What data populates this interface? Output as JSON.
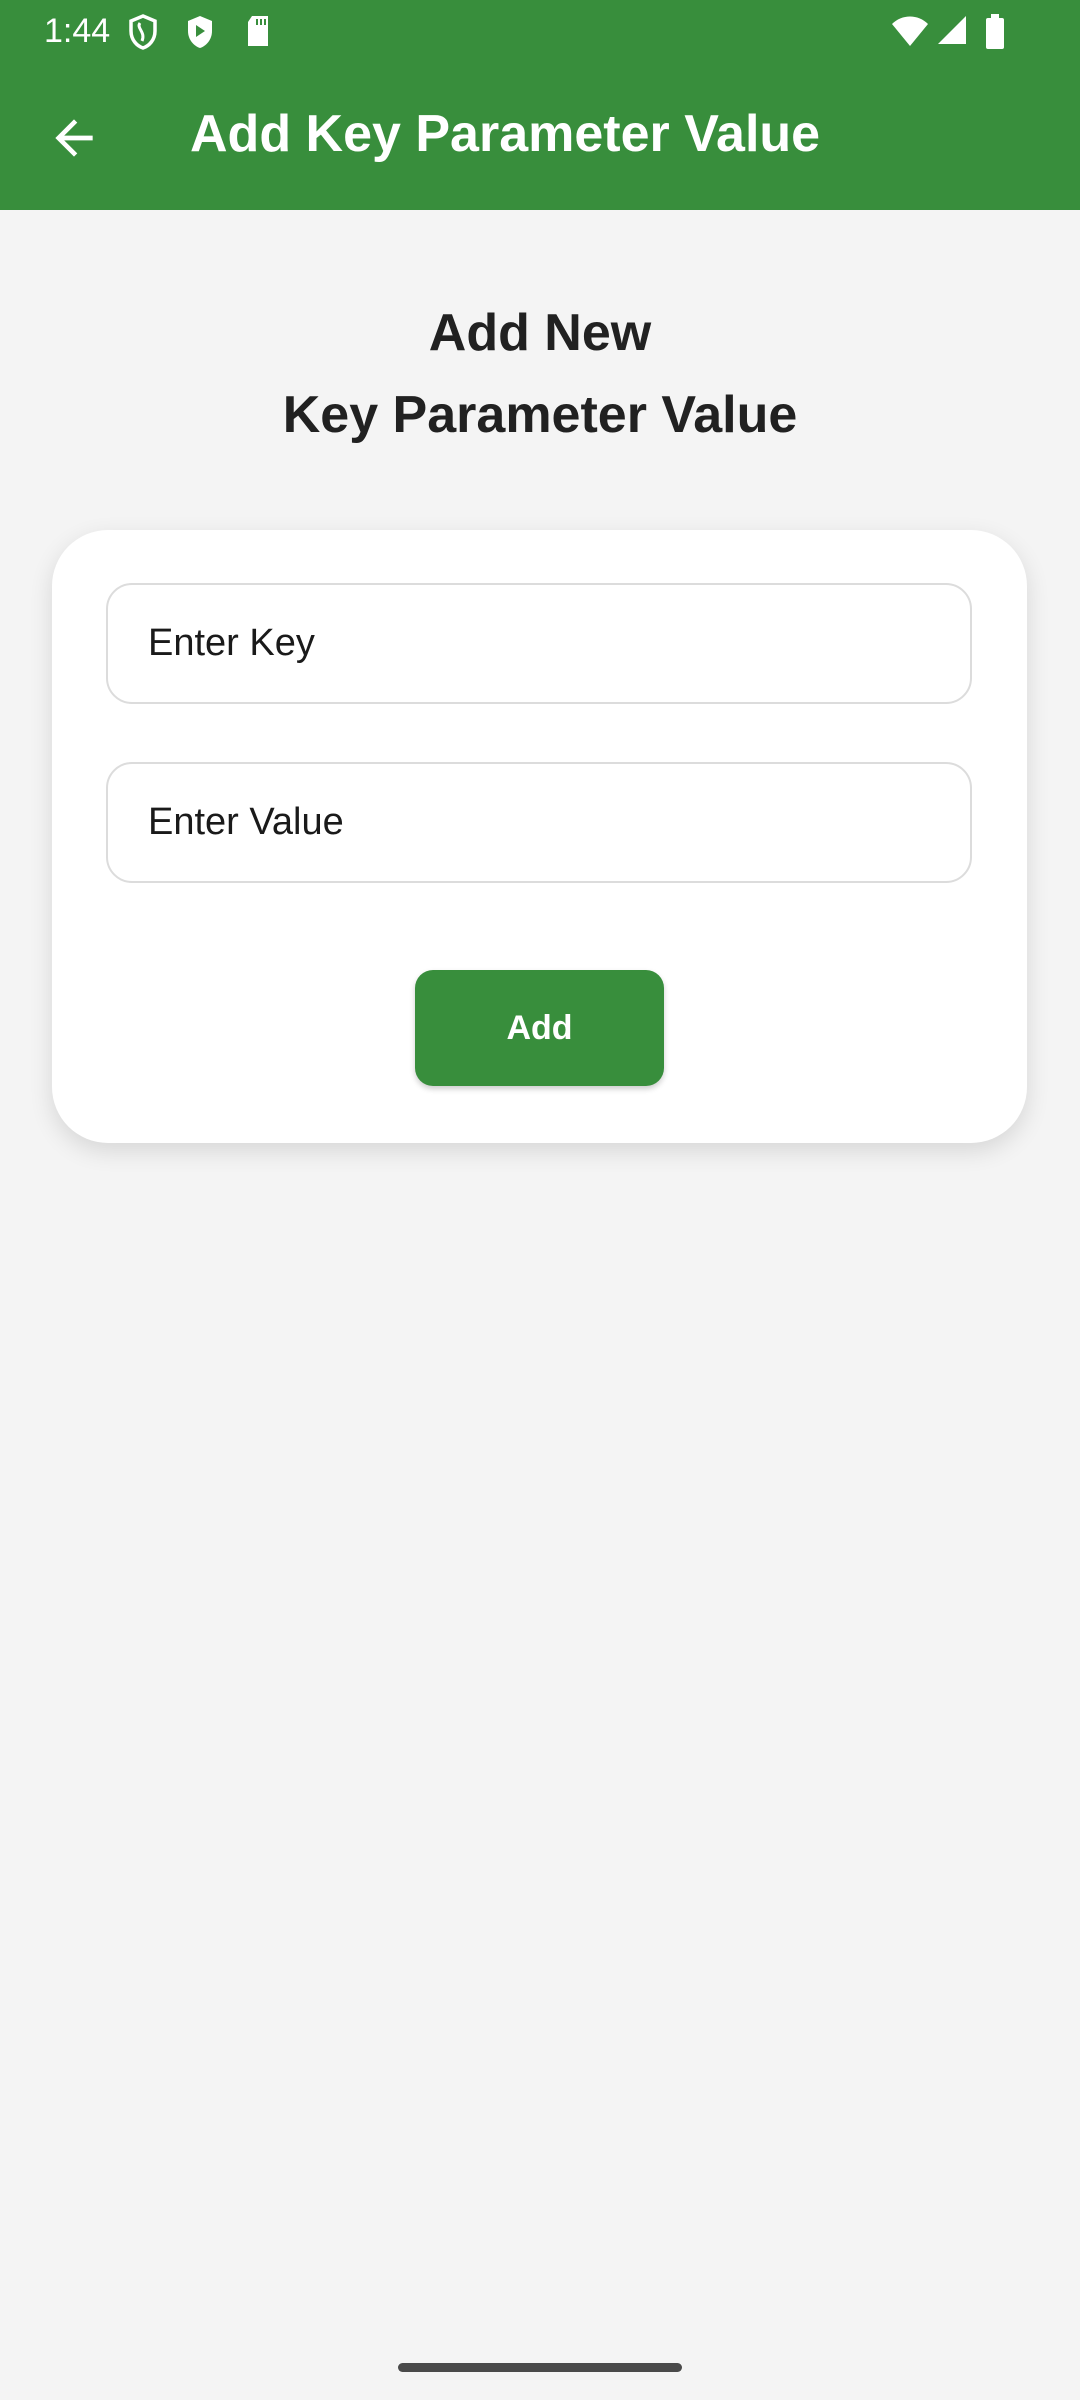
{
  "status_bar": {
    "time": "1:44",
    "left_icons": [
      "shield-icon",
      "play-protect-icon",
      "sd-card-icon"
    ],
    "right_icons": [
      "wifi-icon",
      "signal-icon",
      "battery-icon"
    ]
  },
  "app_bar": {
    "title": "Add Key Parameter Value",
    "back_icon": "arrow-back-icon",
    "color": "#388e3c"
  },
  "heading": {
    "line1": "Add New",
    "line2": "Key Parameter Value"
  },
  "form": {
    "key_placeholder": "Enter Key",
    "value_placeholder": "Enter Value",
    "key_value": "",
    "value_value": "",
    "add_label": "Add"
  }
}
